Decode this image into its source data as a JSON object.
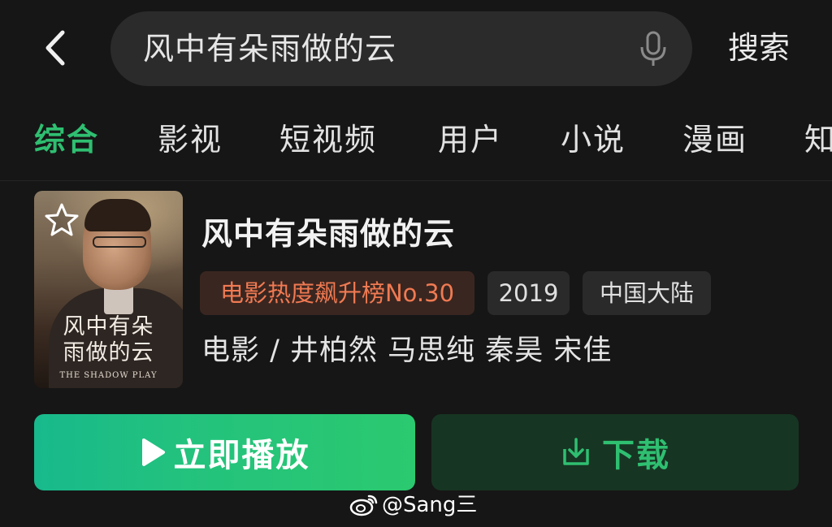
{
  "search": {
    "query": "风中有朵雨做的云",
    "search_label": "搜索"
  },
  "tabs": [
    {
      "label": "综合",
      "active": true
    },
    {
      "label": "影视"
    },
    {
      "label": "短视频"
    },
    {
      "label": "用户"
    },
    {
      "label": "小说"
    },
    {
      "label": "漫画"
    },
    {
      "label": "知"
    }
  ],
  "result": {
    "title": "风中有朵雨做的云",
    "poster": {
      "title_line1": "风中有朵",
      "title_line2": "雨做的云",
      "subtitle": "THE SHADOW PLAY"
    },
    "tags": {
      "rank": "电影热度飙升榜No.30",
      "year": "2019",
      "region": "中国大陆"
    },
    "meta": "电影 / 井柏然  马思纯  秦昊  宋佳"
  },
  "actions": {
    "play_label": "立即播放",
    "download_label": "下载"
  },
  "watermark": "@Sang三",
  "colors": {
    "accent_green": "#2fbf71",
    "rank_orange": "#f07a52",
    "background": "#161616"
  }
}
